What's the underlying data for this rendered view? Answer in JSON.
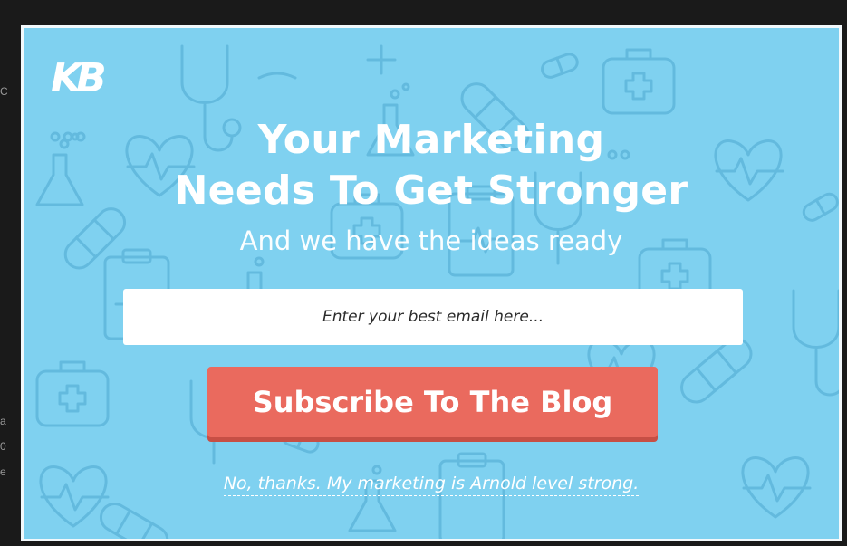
{
  "popup": {
    "logo_text": "KB",
    "headline_line1": "Your Marketing",
    "headline_line2": "Needs To Get Stronger",
    "subheadline": "And we have the ideas ready",
    "email_placeholder": "Enter your best email here...",
    "email_value": "",
    "subscribe_label": "Subscribe To The Blog",
    "decline_label": "No, thanks. My marketing is Arnold level strong."
  },
  "background_page": {
    "edge_fragments": [
      "C",
      "a",
      "0",
      "e"
    ]
  },
  "colors": {
    "modal_bg": "#7fd1f0",
    "pattern_stroke": "#5fb6db",
    "cta_bg": "#ea6a5e",
    "cta_shadow": "#c74f45",
    "text": "#ffffff",
    "input_bg": "#ffffff"
  },
  "icons": [
    "logo-kb",
    "first-aid-kit-icon",
    "bandage-icon",
    "pill-icon",
    "heartbeat-icon",
    "flask-icon",
    "stethoscope-icon",
    "clipboard-icon"
  ]
}
